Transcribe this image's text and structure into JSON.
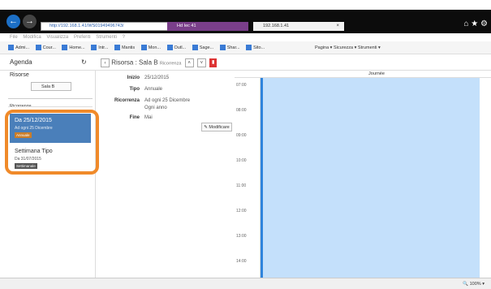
{
  "browser": {
    "address": "http://192.168.1.41/WS01949496743/",
    "tab1": "Hd Iec 41",
    "tab2": "192.168.1.41",
    "menu": [
      "File",
      "Modifica",
      "Visualizza",
      "Preferiti",
      "Strumenti",
      "?"
    ],
    "favorites": [
      "Admi...",
      "Cour...",
      "Home...",
      "Intr...",
      "Mantis",
      "Mon...",
      "Outl...",
      "Sage...",
      "Shar...",
      "Sito..."
    ],
    "fav_tools": "Pagina ▾  Sicurezza ▾  Strumenti ▾",
    "zoom": "100%"
  },
  "app": {
    "agenda_title": "Agenda",
    "resource_title": "Risorsa : Sala B",
    "resource_sub": "Ricorrenza",
    "left": {
      "risorse_label": "Risorse",
      "sala_value": "Sala B",
      "ricorrenze_label": "Ricorrenze",
      "items": [
        {
          "title": "Da 25/12/2015",
          "sub": "Ad ogni 25 Dicembre",
          "badge": "Annuale"
        },
        {
          "title": "Settimana Tipo",
          "sub": "Da 31/07/2015",
          "badge": "Settimanale"
        }
      ]
    },
    "details": {
      "inizio_label": "Inizio",
      "inizio": "25/12/2015",
      "tipo_label": "Tipo",
      "tipo": "Annuale",
      "ricorrenza_label": "Ricorrenza",
      "ricorrenza1": "Ad ogni 25 Dicembre",
      "ricorrenza2": "Ogni anno",
      "fine_label": "Fine",
      "fine": "Mai",
      "modifica": "Modificare"
    },
    "calendar": {
      "header": "Journée",
      "times": [
        "07:00",
        "08:00",
        "09:00",
        "10:00",
        "11:00",
        "12:00",
        "13:00",
        "14:00"
      ]
    }
  }
}
